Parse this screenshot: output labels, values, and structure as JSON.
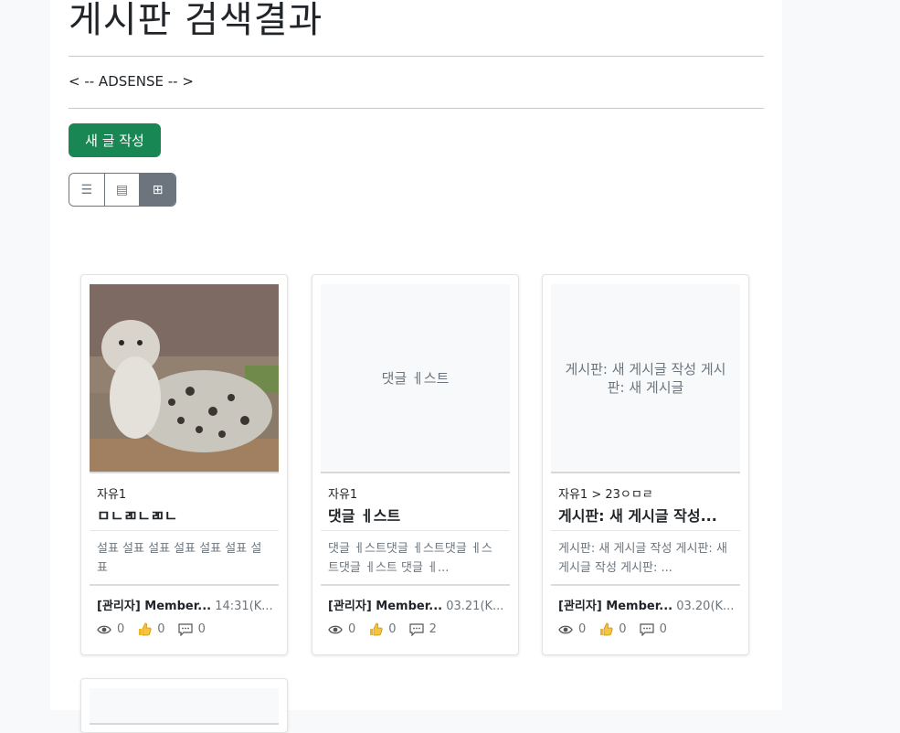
{
  "page": {
    "title": "게시판 검색결과",
    "adsense": "< -- ADSENSE -- >"
  },
  "toolbar": {
    "new_post_label": "새 글 작성"
  },
  "view_modes": [
    {
      "icon": "list-icon",
      "glyph": "☰",
      "active": false
    },
    {
      "icon": "detail-list-icon",
      "glyph": "▤",
      "active": false
    },
    {
      "icon": "grid-icon",
      "glyph": "⊞",
      "active": true
    }
  ],
  "cards": [
    {
      "thumbnail": "image",
      "thumbnail_alt": "snow leopard",
      "category": "자유1",
      "title": "ㅁㄴㄻㄴㄻㄴ",
      "excerpt": "설표 설표 설표 설표 설표 설표 설표",
      "author": "[관리자] Member...",
      "time": "14:31(K...",
      "views": "0",
      "likes": "0",
      "comments": "0"
    },
    {
      "thumbnail": "placeholder",
      "thumbnail_text": "댓글 ㅔ스트",
      "category": "자유1",
      "title": "댓글 ㅔ스트",
      "excerpt": "댓글 ㅔ스트댓글 ㅔ스트댓글 ㅔ스트댓글 ㅔ스트 댓글 ㅔ...",
      "author": "[관리자] Member...",
      "time": "03.21(K...",
      "views": "0",
      "likes": "0",
      "comments": "2"
    },
    {
      "thumbnail": "placeholder",
      "thumbnail_text": "게시판: 새 게시글 작성 게시판: 새 게시글",
      "category": "자유1 > 23ㅇㅁㄹ",
      "title": "게시판: 새 게시글 작성...",
      "excerpt": "게시판: 새 게시글 작성 게시판: 새 게시글 작성 게시판: ...",
      "author": "[관리자] Member...",
      "time": "03.20(K...",
      "views": "0",
      "likes": "0",
      "comments": "0"
    }
  ]
}
